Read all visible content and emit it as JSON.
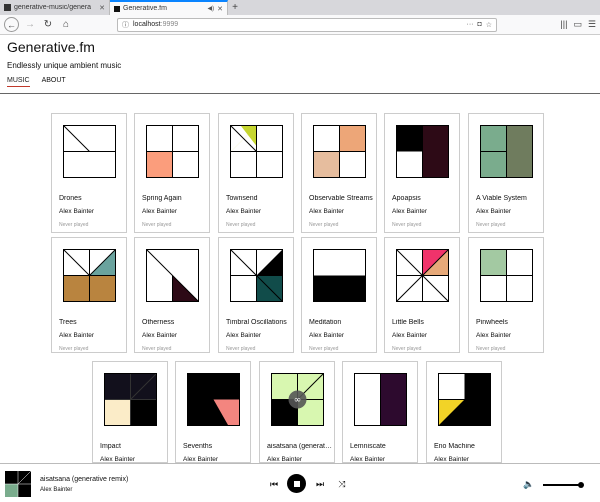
{
  "browser": {
    "tabs": [
      {
        "title": "generative-music/genera",
        "active": false
      },
      {
        "title": "Generative.fm",
        "active": true
      }
    ],
    "url_host": "localhost",
    "url_port": ":9999"
  },
  "app": {
    "title": "Generative.fm",
    "tagline": "Endlessly unique ambient music",
    "nav": [
      {
        "label": "MUSIC",
        "active": true
      },
      {
        "label": "ABOUT",
        "active": false
      }
    ]
  },
  "pieces": [
    {
      "title": "Drones",
      "artist": "Alex Bainter",
      "played": "Never played"
    },
    {
      "title": "Spring Again",
      "artist": "Alex Bainter",
      "played": "Never played"
    },
    {
      "title": "Townsend",
      "artist": "Alex Bainter",
      "played": "Never played"
    },
    {
      "title": "Observable Streams",
      "artist": "Alex Bainter",
      "played": "Never played"
    },
    {
      "title": "Apoapsis",
      "artist": "Alex Bainter",
      "played": "Never played"
    },
    {
      "title": "A Viable System",
      "artist": "Alex Bainter",
      "played": "Never played"
    },
    {
      "title": "Trees",
      "artist": "Alex Bainter",
      "played": "Never played"
    },
    {
      "title": "Otherness",
      "artist": "Alex Bainter",
      "played": "Never played"
    },
    {
      "title": "Timbral Oscillations",
      "artist": "Alex Bainter",
      "played": "Never played"
    },
    {
      "title": "Meditation",
      "artist": "Alex Bainter",
      "played": "Never played"
    },
    {
      "title": "Little Bells",
      "artist": "Alex Bainter",
      "played": "Never played"
    },
    {
      "title": "Pinwheels",
      "artist": "Alex Bainter",
      "played": "Never played"
    },
    {
      "title": "Impact",
      "artist": "Alex Bainter",
      "played": ""
    },
    {
      "title": "Sevenths",
      "artist": "Alex Bainter",
      "played": ""
    },
    {
      "title": "aisatsana (generative remix)",
      "artist": "Alex Bainter",
      "played": ""
    },
    {
      "title": "Lemniscate",
      "artist": "Alex Bainter",
      "played": ""
    },
    {
      "title": "Eno Machine",
      "artist": "Alex Bainter",
      "played": ""
    }
  ],
  "player": {
    "title": "aisatsana (generative remix)",
    "artist": "Alex Bainter",
    "volume": 0.9
  },
  "icons": {
    "back": "back-arrow-icon",
    "forward": "forward-arrow-icon",
    "reload": "reload-icon",
    "home": "home-icon",
    "prev": "skip-previous-icon",
    "stop": "stop-icon",
    "next": "skip-next-icon",
    "shuffle": "shuffle-icon",
    "volume": "volume-icon"
  }
}
